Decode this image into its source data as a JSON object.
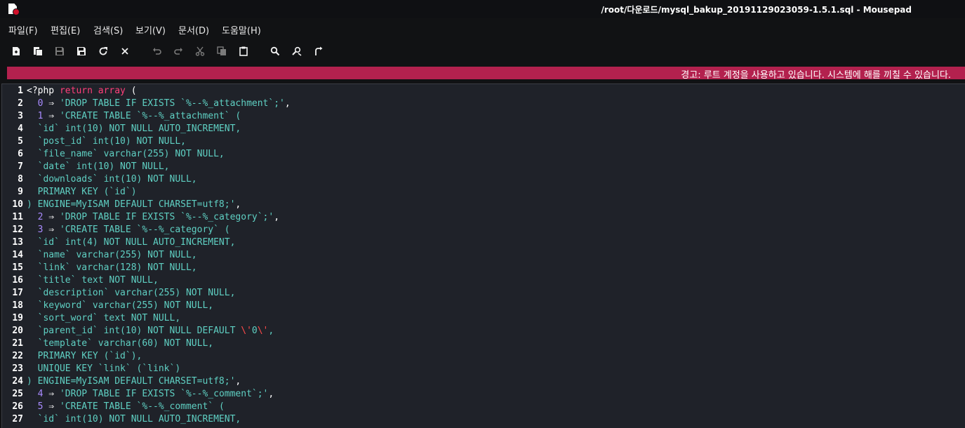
{
  "window": {
    "title": "/root/다운로드/mysql_bakup_20191129023059-1.5.1.sql - Mousepad",
    "app_icon": "document-error-icon"
  },
  "menu": [
    "파일(F)",
    "편집(E)",
    "검색(S)",
    "보기(V)",
    "문서(D)",
    "도움말(H)"
  ],
  "toolbar": [
    {
      "name": "new-document-icon",
      "glyph": "new"
    },
    {
      "name": "new-window-icon",
      "glyph": "newwin"
    },
    {
      "name": "save-icon",
      "glyph": "save",
      "disabled": true
    },
    {
      "name": "save-as-icon",
      "glyph": "saveas"
    },
    {
      "name": "reload-icon",
      "glyph": "reload"
    },
    {
      "name": "close-icon",
      "glyph": "close"
    },
    {
      "name": "undo-icon",
      "glyph": "undo",
      "disabled": true
    },
    {
      "name": "redo-icon",
      "glyph": "redo",
      "disabled": true
    },
    {
      "name": "cut-icon",
      "glyph": "cut",
      "disabled": true
    },
    {
      "name": "copy-icon",
      "glyph": "copy",
      "disabled": true
    },
    {
      "name": "paste-icon",
      "glyph": "paste"
    },
    {
      "name": "find-icon",
      "glyph": "find"
    },
    {
      "name": "find-replace-icon",
      "glyph": "replace"
    },
    {
      "name": "goto-line-icon",
      "glyph": "goto"
    }
  ],
  "warning": "경고: 루트 계정을 사용하고 있습니다. 시스템에 해를 끼칠 수 있습니다.",
  "colors": {
    "warning_bg": "#b3214e",
    "keyword": "#ff3f7a",
    "number": "#a98bff",
    "string": "#5fd0c3",
    "escape": "#ff4a4a"
  },
  "editor": {
    "lines": [
      {
        "n": "1",
        "segs": [
          [
            "w",
            "<?php "
          ],
          [
            "k",
            "return array"
          ],
          [
            "w",
            " ("
          ]
        ]
      },
      {
        "n": "2",
        "segs": [
          [
            "s",
            "  "
          ],
          [
            "n",
            "0"
          ],
          [
            "w",
            " ⇒ "
          ],
          [
            "s",
            "'DROP TABLE IF EXISTS `%--%_attachment`;'"
          ],
          [
            "w",
            ","
          ]
        ]
      },
      {
        "n": "3",
        "segs": [
          [
            "s",
            "  "
          ],
          [
            "n",
            "1"
          ],
          [
            "w",
            " ⇒ "
          ],
          [
            "s",
            "'CREATE TABLE `%--%_attachment` ("
          ]
        ]
      },
      {
        "n": "4",
        "segs": [
          [
            "s",
            "  `id` int(10) NOT NULL AUTO_INCREMENT,"
          ]
        ]
      },
      {
        "n": "5",
        "segs": [
          [
            "s",
            "  `post_id` int(10) NOT NULL,"
          ]
        ]
      },
      {
        "n": "6",
        "segs": [
          [
            "s",
            "  `file_name` varchar(255) NOT NULL,"
          ]
        ]
      },
      {
        "n": "7",
        "segs": [
          [
            "s",
            "  `date` int(10) NOT NULL,"
          ]
        ]
      },
      {
        "n": "8",
        "segs": [
          [
            "s",
            "  `downloads` int(10) NOT NULL,"
          ]
        ]
      },
      {
        "n": "9",
        "segs": [
          [
            "s",
            "  PRIMARY KEY (`id`)"
          ]
        ]
      },
      {
        "n": "10",
        "segs": [
          [
            "s",
            ") ENGINE=MyISAM DEFAULT CHARSET=utf8;'"
          ],
          [
            "w",
            ","
          ]
        ]
      },
      {
        "n": "11",
        "segs": [
          [
            "s",
            "  "
          ],
          [
            "n",
            "2"
          ],
          [
            "w",
            " ⇒ "
          ],
          [
            "s",
            "'DROP TABLE IF EXISTS `%--%_category`;'"
          ],
          [
            "w",
            ","
          ]
        ]
      },
      {
        "n": "12",
        "segs": [
          [
            "s",
            "  "
          ],
          [
            "n",
            "3"
          ],
          [
            "w",
            " ⇒ "
          ],
          [
            "s",
            "'CREATE TABLE `%--%_category` ("
          ]
        ]
      },
      {
        "n": "13",
        "segs": [
          [
            "s",
            "  `id` int(4) NOT NULL AUTO_INCREMENT,"
          ]
        ]
      },
      {
        "n": "14",
        "segs": [
          [
            "s",
            "  `name` varchar(255) NOT NULL,"
          ]
        ]
      },
      {
        "n": "15",
        "segs": [
          [
            "s",
            "  `link` varchar(128) NOT NULL,"
          ]
        ]
      },
      {
        "n": "16",
        "segs": [
          [
            "s",
            "  `title` text NOT NULL,"
          ]
        ]
      },
      {
        "n": "17",
        "segs": [
          [
            "s",
            "  `description` varchar(255) NOT NULL,"
          ]
        ]
      },
      {
        "n": "18",
        "segs": [
          [
            "s",
            "  `keyword` varchar(255) NOT NULL,"
          ]
        ]
      },
      {
        "n": "19",
        "segs": [
          [
            "s",
            "  `sort_word` text NOT NULL,"
          ]
        ]
      },
      {
        "n": "20",
        "segs": [
          [
            "s",
            "  `parent_id` int(10) NOT NULL DEFAULT "
          ],
          [
            "esc",
            "\\'"
          ],
          [
            "s",
            "0"
          ],
          [
            "esc",
            "\\'"
          ],
          [
            "s",
            ","
          ]
        ]
      },
      {
        "n": "21",
        "segs": [
          [
            "s",
            "  `template` varchar(60) NOT NULL,"
          ]
        ]
      },
      {
        "n": "22",
        "segs": [
          [
            "s",
            "  PRIMARY KEY (`id`),"
          ]
        ]
      },
      {
        "n": "23",
        "segs": [
          [
            "s",
            "  UNIQUE KEY `link` (`link`)"
          ]
        ]
      },
      {
        "n": "24",
        "segs": [
          [
            "s",
            ") ENGINE=MyISAM DEFAULT CHARSET=utf8;'"
          ],
          [
            "w",
            ","
          ]
        ]
      },
      {
        "n": "25",
        "segs": [
          [
            "s",
            "  "
          ],
          [
            "n",
            "4"
          ],
          [
            "w",
            " ⇒ "
          ],
          [
            "s",
            "'DROP TABLE IF EXISTS `%--%_comment`;'"
          ],
          [
            "w",
            ","
          ]
        ]
      },
      {
        "n": "26",
        "segs": [
          [
            "s",
            "  "
          ],
          [
            "n",
            "5"
          ],
          [
            "w",
            " ⇒ "
          ],
          [
            "s",
            "'CREATE TABLE `%--%_comment` ("
          ]
        ]
      },
      {
        "n": "27",
        "segs": [
          [
            "s",
            "  `id` int(10) NOT NULL AUTO_INCREMENT,"
          ]
        ]
      }
    ]
  }
}
